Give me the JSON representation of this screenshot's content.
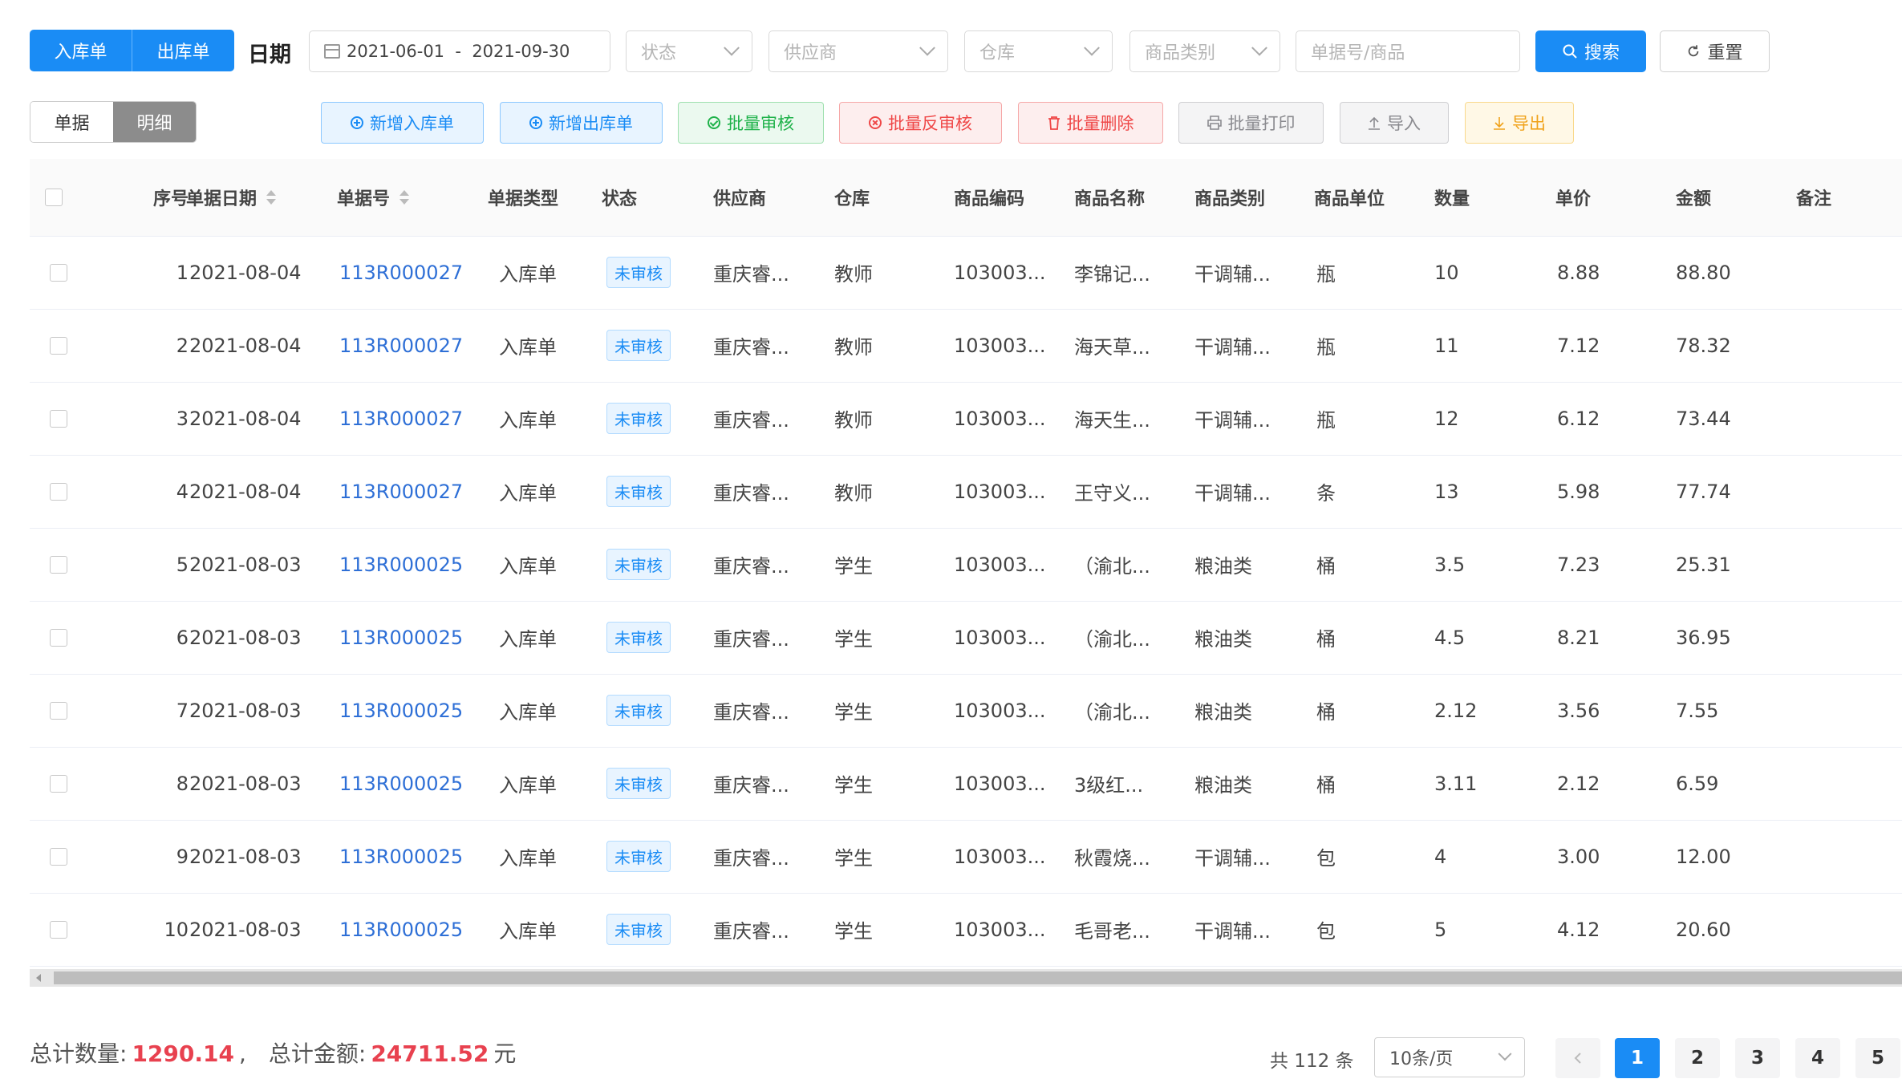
{
  "top_tabs": [
    "入库单",
    "出库单"
  ],
  "date_label": "日期",
  "date_range": "2021-06-01  -  2021-09-30",
  "filters": {
    "status": "状态",
    "supplier": "供应商",
    "warehouse": "仓库",
    "category": "商品类别",
    "keyword_placeholder": "单据号/商品"
  },
  "search_label": "搜索",
  "reset_label": "重置",
  "view_tabs": [
    "单据",
    "明细"
  ],
  "actions": {
    "new_in": "新增入库单",
    "new_out": "新增出库单",
    "batch_audit": "批量审核",
    "batch_unaudit": "批量反审核",
    "batch_delete": "批量删除",
    "batch_print": "批量打印",
    "import": "导入",
    "export": "导出"
  },
  "columns": [
    "序号",
    "单据日期",
    "单据号",
    "单据类型",
    "状态",
    "供应商",
    "仓库",
    "商品编码",
    "商品名称",
    "商品类别",
    "商品单位",
    "数量",
    "单价",
    "金额",
    "备注"
  ],
  "rows": [
    {
      "idx": "1",
      "date": "2021-08-04",
      "doc": "113R000027",
      "type": "入库单",
      "status": "未审核",
      "supplier": "重庆睿...",
      "wh": "教师",
      "code": "103003...",
      "name": "李锦记...",
      "cat": "干调辅...",
      "unit": "瓶",
      "qty": "10",
      "price": "8.88",
      "amount": "88.80",
      "note": ""
    },
    {
      "idx": "2",
      "date": "2021-08-04",
      "doc": "113R000027",
      "type": "入库单",
      "status": "未审核",
      "supplier": "重庆睿...",
      "wh": "教师",
      "code": "103003...",
      "name": "海天草...",
      "cat": "干调辅...",
      "unit": "瓶",
      "qty": "11",
      "price": "7.12",
      "amount": "78.32",
      "note": ""
    },
    {
      "idx": "3",
      "date": "2021-08-04",
      "doc": "113R000027",
      "type": "入库单",
      "status": "未审核",
      "supplier": "重庆睿...",
      "wh": "教师",
      "code": "103003...",
      "name": "海天生...",
      "cat": "干调辅...",
      "unit": "瓶",
      "qty": "12",
      "price": "6.12",
      "amount": "73.44",
      "note": ""
    },
    {
      "idx": "4",
      "date": "2021-08-04",
      "doc": "113R000027",
      "type": "入库单",
      "status": "未审核",
      "supplier": "重庆睿...",
      "wh": "教师",
      "code": "103003...",
      "name": "王守义...",
      "cat": "干调辅...",
      "unit": "条",
      "qty": "13",
      "price": "5.98",
      "amount": "77.74",
      "note": ""
    },
    {
      "idx": "5",
      "date": "2021-08-03",
      "doc": "113R000025",
      "type": "入库单",
      "status": "未审核",
      "supplier": "重庆睿...",
      "wh": "学生",
      "code": "103003...",
      "name": "（渝北...",
      "cat": "粮油类",
      "unit": "桶",
      "qty": "3.5",
      "price": "7.23",
      "amount": "25.31",
      "note": ""
    },
    {
      "idx": "6",
      "date": "2021-08-03",
      "doc": "113R000025",
      "type": "入库单",
      "status": "未审核",
      "supplier": "重庆睿...",
      "wh": "学生",
      "code": "103003...",
      "name": "（渝北...",
      "cat": "粮油类",
      "unit": "桶",
      "qty": "4.5",
      "price": "8.21",
      "amount": "36.95",
      "note": ""
    },
    {
      "idx": "7",
      "date": "2021-08-03",
      "doc": "113R000025",
      "type": "入库单",
      "status": "未审核",
      "supplier": "重庆睿...",
      "wh": "学生",
      "code": "103003...",
      "name": "（渝北...",
      "cat": "粮油类",
      "unit": "桶",
      "qty": "2.12",
      "price": "3.56",
      "amount": "7.55",
      "note": ""
    },
    {
      "idx": "8",
      "date": "2021-08-03",
      "doc": "113R000025",
      "type": "入库单",
      "status": "未审核",
      "supplier": "重庆睿...",
      "wh": "学生",
      "code": "103003...",
      "name": "3级红...",
      "cat": "粮油类",
      "unit": "桶",
      "qty": "3.11",
      "price": "2.12",
      "amount": "6.59",
      "note": ""
    },
    {
      "idx": "9",
      "date": "2021-08-03",
      "doc": "113R000025",
      "type": "入库单",
      "status": "未审核",
      "supplier": "重庆睿...",
      "wh": "学生",
      "code": "103003...",
      "name": "秋霞烧...",
      "cat": "干调辅...",
      "unit": "包",
      "qty": "4",
      "price": "3.00",
      "amount": "12.00",
      "note": ""
    },
    {
      "idx": "10",
      "date": "2021-08-03",
      "doc": "113R000025",
      "type": "入库单",
      "status": "未审核",
      "supplier": "重庆睿...",
      "wh": "学生",
      "code": "103003...",
      "name": "毛哥老...",
      "cat": "干调辅...",
      "unit": "包",
      "qty": "5",
      "price": "4.12",
      "amount": "20.60",
      "note": ""
    }
  ],
  "totals": {
    "qty_label": "总计数量:",
    "qty": "1290.14",
    "sep": ",",
    "amount_label": "总计金额:",
    "amount": "24711.52",
    "currency": "元"
  },
  "pagination": {
    "total_text": "共 112 条",
    "page_size": "10条/页",
    "pages": [
      "1",
      "2",
      "3",
      "4",
      "5"
    ],
    "current": "1"
  }
}
